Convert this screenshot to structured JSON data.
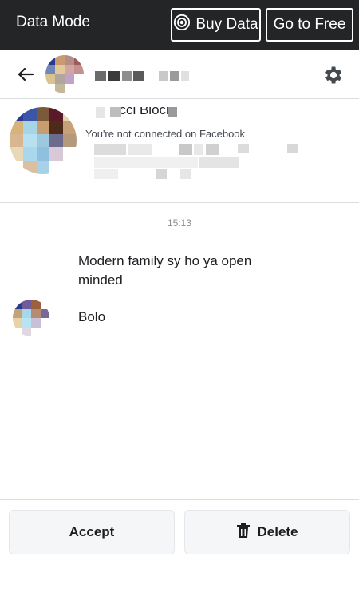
{
  "topbar": {
    "mode_label": "Data Mode",
    "buy_label": "Buy Data",
    "free_label": "Go to Free"
  },
  "header": {
    "back_icon": "arrow-left-icon",
    "settings_icon": "gear-icon"
  },
  "profile": {
    "name_fragment": "acci Bloch",
    "connection_status": "You're not connected on Facebook"
  },
  "conversation": {
    "timestamp": "15:13",
    "messages": [
      {
        "text": "Modern family sy ho ya open minded"
      },
      {
        "text": "Bolo"
      }
    ]
  },
  "actions": {
    "accept_label": "Accept",
    "delete_label": "Delete",
    "delete_icon": "trash-icon"
  },
  "colors": {
    "topbar_bg": "#242526",
    "button_bg": "#f5f6f8",
    "divider": "#dadde1"
  }
}
